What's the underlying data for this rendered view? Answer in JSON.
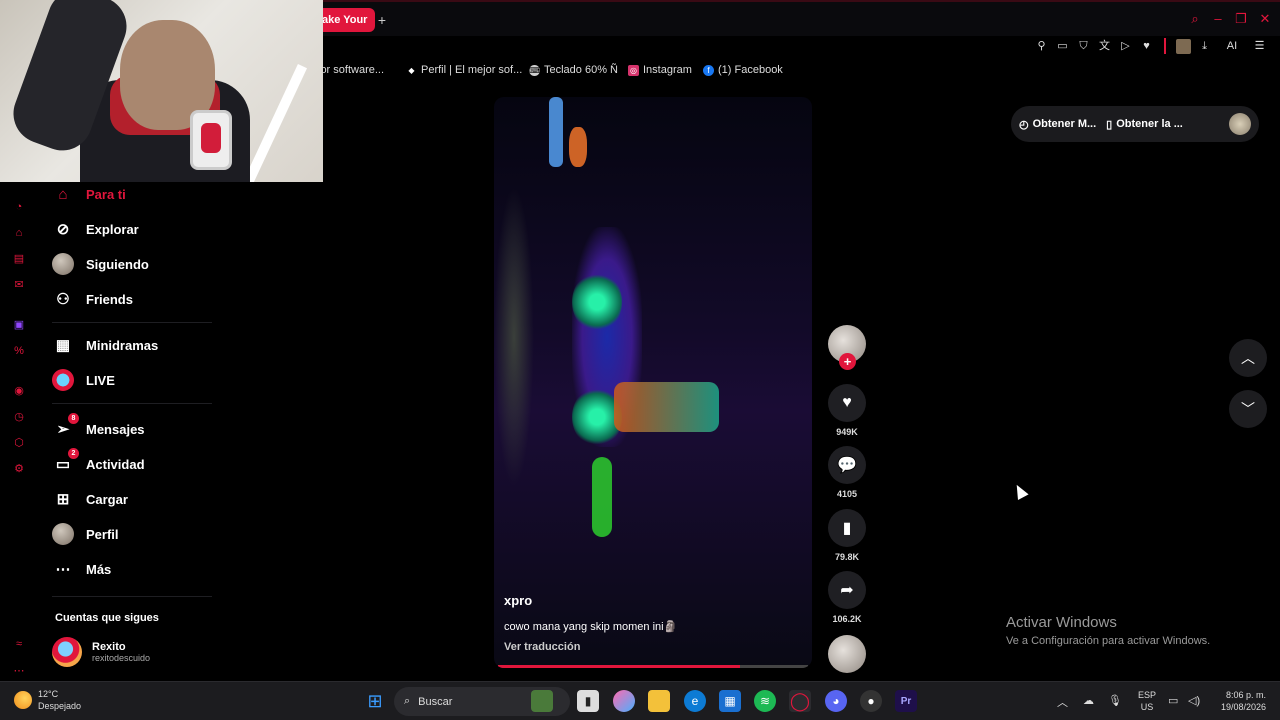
{
  "browser": {
    "tab_title": "ake Your",
    "new_tab": "+",
    "toolbar_ai": "AI"
  },
  "bookmarks": [
    {
      "label": "jor software...",
      "icon": "bookmark-icon",
      "color": "#888888"
    },
    {
      "label": "Perfil | El mejor sof...",
      "icon": "diamond-icon",
      "color": "#ffffff"
    },
    {
      "label": "Teclado 60% Ñ",
      "icon": "keyboard-icon",
      "color": "#cfcfcf"
    },
    {
      "label": "Instagram",
      "icon": "instagram-icon",
      "color": "#d6336c"
    },
    {
      "label": "(1) Facebook",
      "icon": "facebook-icon",
      "color": "#1877f2"
    }
  ],
  "sidebar": {
    "items": [
      {
        "label": "Para ti",
        "icon": "home-icon"
      },
      {
        "label": "Explorar",
        "icon": "compass-icon"
      },
      {
        "label": "Siguiendo",
        "icon": "avatar-icon"
      },
      {
        "label": "Friends",
        "icon": "friends-icon"
      },
      {
        "label": "Minidramas",
        "icon": "film-icon"
      },
      {
        "label": "LIVE",
        "icon": "live-icon"
      },
      {
        "label": "Mensajes",
        "icon": "send-icon",
        "badge": "8"
      },
      {
        "label": "Actividad",
        "icon": "activity-icon",
        "badge": "2"
      },
      {
        "label": "Cargar",
        "icon": "upload-icon"
      },
      {
        "label": "Perfil",
        "icon": "profile-icon"
      },
      {
        "label": "Más",
        "icon": "more-icon"
      }
    ],
    "following_title": "Cuentas que sigues",
    "following": [
      {
        "name": "Rexito",
        "user": "rexitodescuido"
      }
    ]
  },
  "video": {
    "author": "xpro",
    "description": "cowo mana yang skip momen ini🗿",
    "translate": "Ver traducción",
    "progress": 0.78
  },
  "actions": {
    "likes": "949K",
    "comments": "4105",
    "saves": "79.8K",
    "shares": "106.2K"
  },
  "top_pills": {
    "item1": "Obtener M...",
    "item2": "Obtener la ..."
  },
  "watermark": {
    "line1": "Activar Windows",
    "line2": "Ve a Configuración para activar Windows."
  },
  "taskbar": {
    "temp": "12°C",
    "condition": "Despejado",
    "search_placeholder": "Buscar",
    "lang1": "ESP",
    "lang2": "US",
    "time": "8:06 p. m.",
    "date": "19/08/2026"
  },
  "colors": {
    "accent": "#e1163c",
    "background": "#000000"
  }
}
